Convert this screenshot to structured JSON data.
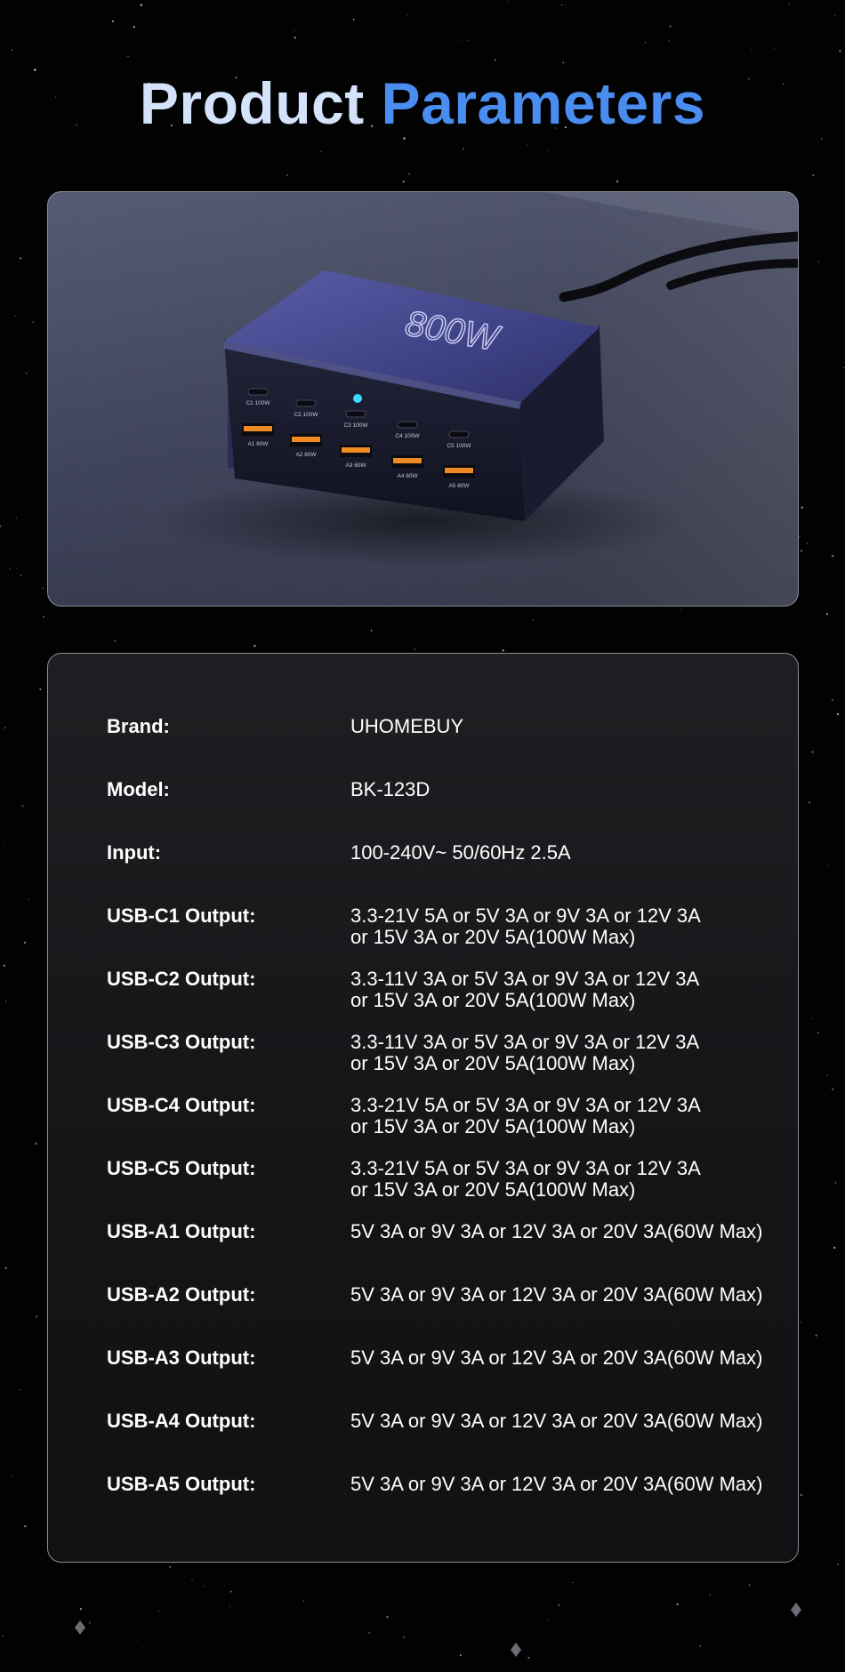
{
  "title": {
    "part1": "Product Parameters",
    "part2": ""
  },
  "product_image": {
    "badge_text": "800W",
    "ports_c": [
      "C1 100W",
      "C2 100W",
      "C3 100W",
      "C4 100W",
      "C5 100W"
    ],
    "ports_a": [
      "A1 60W",
      "A2 60W",
      "A3 60W",
      "A4 60W",
      "A5 60W"
    ]
  },
  "specs": [
    {
      "label": "Brand:",
      "value": [
        "UHOMEBUY"
      ]
    },
    {
      "label": "Model:",
      "value": [
        "BK-123D"
      ]
    },
    {
      "label": "Input:",
      "value": [
        "100-240V~ 50/60Hz 2.5A"
      ]
    },
    {
      "label": "USB-C1 Output:",
      "value": [
        "3.3-21V 5A or 5V 3A or 9V 3A or 12V 3A",
        "or 15V 3A or 20V 5A(100W Max)"
      ]
    },
    {
      "label": "USB-C2 Output:",
      "value": [
        "3.3-11V 3A or 5V 3A or 9V 3A or 12V 3A",
        "or 15V 3A or 20V 5A(100W Max)"
      ]
    },
    {
      "label": "USB-C3 Output:",
      "value": [
        "3.3-11V 3A or 5V 3A or 9V 3A or 12V 3A",
        "or 15V 3A or 20V 5A(100W Max)"
      ]
    },
    {
      "label": "USB-C4 Output:",
      "value": [
        "3.3-21V 5A or 5V 3A or 9V 3A or 12V 3A",
        "or 15V 3A or 20V 5A(100W Max)"
      ]
    },
    {
      "label": "USB-C5 Output:",
      "value": [
        "3.3-21V 5A or 5V 3A or 9V 3A or 12V 3A",
        "or 15V 3A or 20V 5A(100W Max)"
      ]
    },
    {
      "label": "USB-A1 Output:",
      "value": [
        "5V 3A or 9V 3A or 12V 3A or 20V 3A(60W Max)"
      ]
    },
    {
      "label": "USB-A2 Output:",
      "value": [
        "5V 3A or 9V 3A or 12V 3A or 20V 3A(60W Max)"
      ]
    },
    {
      "label": "USB-A3 Output:",
      "value": [
        "5V 3A or 9V 3A or 12V 3A or 20V 3A(60W Max)"
      ]
    },
    {
      "label": "USB-A4 Output:",
      "value": [
        "5V 3A or 9V 3A or 12V 3A or 20V 3A(60W Max)"
      ]
    },
    {
      "label": "USB-A5 Output:",
      "value": [
        "5V 3A or 9V 3A or 12V 3A or 20V 3A(60W Max)"
      ]
    }
  ]
}
